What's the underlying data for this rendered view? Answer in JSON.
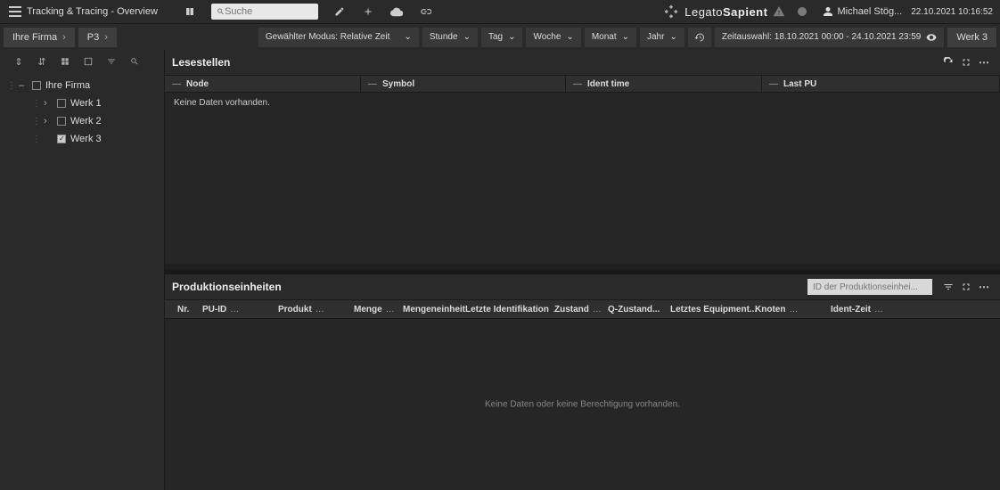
{
  "topbar": {
    "title": "Tracking & Tracing - Overview",
    "search_placeholder": "Suche",
    "logo_text1": "Legato",
    "logo_text2": "Sapient",
    "user_name": "Michael Stög...",
    "datetime": "22.10.2021 10:16:52"
  },
  "subbar": {
    "crumb1": "Ihre Firma",
    "crumb2": "P3",
    "mode_label": "Gewählter Modus: Relative Zeit",
    "btn_hour": "Stunde",
    "btn_day": "Tag",
    "btn_week": "Woche",
    "btn_month": "Monat",
    "btn_year": "Jahr",
    "time_range_label": "Zeitauswahl: 18.10.2021 00:00 - 24.10.2021 23:59",
    "werk_chip": "Werk 3"
  },
  "tree": {
    "root": "Ihre Firma",
    "n1": "Werk 1",
    "n2": "Werk 2",
    "n3": "Werk 3"
  },
  "panel1": {
    "title": "Lesestellen",
    "col_node": "Node",
    "col_symbol": "Symbol",
    "col_ident": "Ident time",
    "col_lastpu": "Last PU",
    "no_data": "Keine Daten vorhanden."
  },
  "panel2": {
    "title": "Produktionseinheiten",
    "filter_placeholder": "ID der Produktionseinhei...",
    "col_nr": "Nr.",
    "col_puid": "PU-ID",
    "col_produkt": "Produkt",
    "col_menge": "Menge",
    "col_mengeneinheit": "Mengeneinheit",
    "col_letzteident": "Letzte Identifikation",
    "col_zustand": "Zustand",
    "col_qzustand": "Q-Zustand...",
    "col_letztesequip": "Letztes Equipment...",
    "col_knoten": "Knoten",
    "col_identzeit": "Ident-Zeit",
    "no_data": "Keine Daten oder keine Berechtigung vorhanden."
  }
}
